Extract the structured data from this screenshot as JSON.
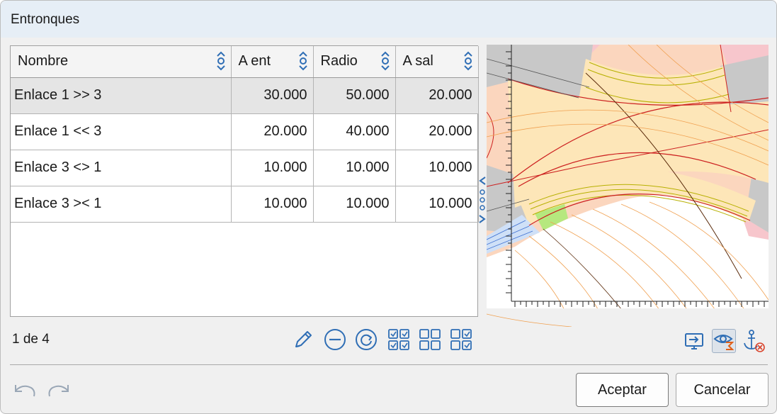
{
  "window": {
    "title": "Entronques"
  },
  "table": {
    "columns": [
      {
        "label": "Nombre"
      },
      {
        "label": "A ent"
      },
      {
        "label": "Radio"
      },
      {
        "label": "A sal"
      }
    ],
    "rows": [
      {
        "nombre": "Enlace 1 >> 3",
        "a_ent": "30.000",
        "radio": "50.000",
        "a_sal": "20.000",
        "selected": true
      },
      {
        "nombre": "Enlace 1 << 3",
        "a_ent": "20.000",
        "radio": "40.000",
        "a_sal": "20.000",
        "selected": false
      },
      {
        "nombre": "Enlace 3 <> 1",
        "a_ent": "10.000",
        "radio": "10.000",
        "a_sal": "10.000",
        "selected": false
      },
      {
        "nombre": "Enlace 3 >< 1",
        "a_ent": "10.000",
        "radio": "10.000",
        "a_sal": "10.000",
        "selected": false
      }
    ]
  },
  "status": {
    "record_count": "1 de 4"
  },
  "toolbar": {
    "icons": [
      "pencil-icon",
      "remove-circle-icon",
      "refresh-circle-icon",
      "check-all-icon",
      "grid-empty-icon",
      "check-some-icon"
    ]
  },
  "preview": {
    "icons": [
      "display-arrow-icon",
      "eye-sum-icon",
      "anchor-remove-icon"
    ]
  },
  "buttons": {
    "accept": "Aceptar",
    "cancel": "Cancelar"
  },
  "colors": {
    "accent": "#2f6eb5",
    "selected_row": "#e5e5e5",
    "road_fill": "#fde6b8",
    "road_line": "#cc1f1f"
  }
}
